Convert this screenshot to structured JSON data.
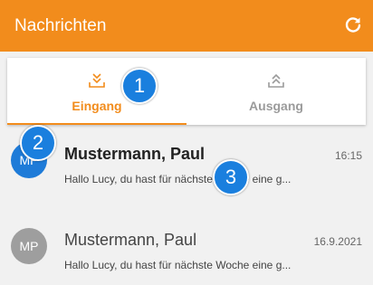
{
  "appbar": {
    "title": "Nachrichten",
    "refresh_icon": "refresh-icon",
    "background_color": "#f28c1c"
  },
  "tabs": [
    {
      "label": "Eingang",
      "icon": "inbox-tray-icon",
      "active": true
    },
    {
      "label": "Ausgang",
      "icon": "outbox-tray-icon",
      "active": false
    }
  ],
  "messages": [
    {
      "initials": "MP",
      "sender": "Mustermann, Paul",
      "time": "16:15",
      "preview": "Hallo Lucy, du hast für nächste Woche eine g...",
      "unread": true,
      "avatar_color": "#1e7bd8"
    },
    {
      "initials": "MP",
      "sender": "Mustermann, Paul",
      "time": "16.9.2021",
      "preview": "Hallo Lucy, du hast für nächste Woche eine g...",
      "unread": false,
      "avatar_color": "#9e9e9e"
    }
  ],
  "annotations": [
    "1",
    "2",
    "3"
  ],
  "accent_color": "#f28c1c",
  "badge_color": "#1a7fde"
}
